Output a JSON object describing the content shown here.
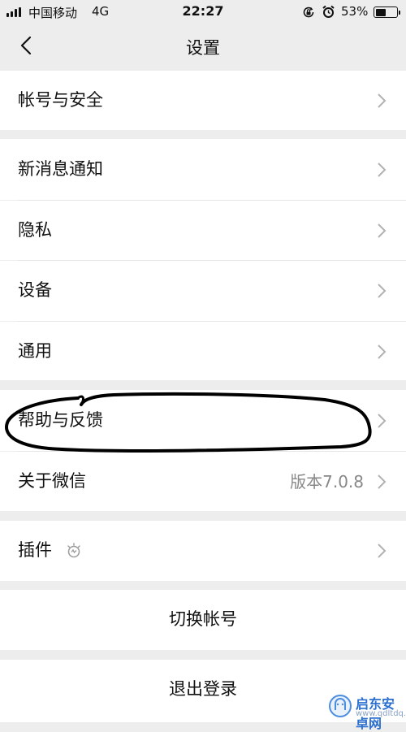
{
  "status_bar": {
    "carrier": "中国移动",
    "network": "4G",
    "time": "22:27",
    "battery": "53%",
    "battery_level": 0.53
  },
  "nav": {
    "title": "设置"
  },
  "settings": {
    "account_security": "帐号与安全",
    "new_message_notifications": "新消息通知",
    "privacy": "隐私",
    "devices": "设备",
    "general": "通用",
    "help_feedback": "帮助与反馈",
    "about_wechat": "关于微信",
    "version": "版本7.0.8",
    "plugins": "插件"
  },
  "actions": {
    "switch_account": "切换帐号",
    "logout": "退出登录"
  },
  "watermark": {
    "title": "启东安卓网",
    "url": "www.qdltdq.com"
  },
  "colors": {
    "background": "#ededed",
    "row": "#ffffff",
    "chevron": "#b2b2b2",
    "secondary_text": "#888888"
  }
}
